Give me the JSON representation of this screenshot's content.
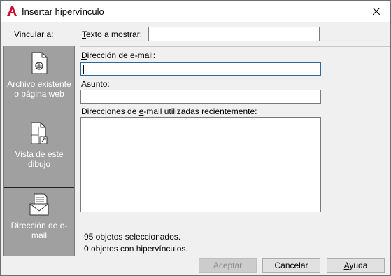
{
  "window": {
    "title": "Insertar hipervínculo",
    "icon": "autocad-a-icon",
    "accent": "#c8102e"
  },
  "link_to": {
    "label": "Vincular a:",
    "items": [
      {
        "label": "Archivo existente o página web",
        "icon": "file-web-icon",
        "selected": false
      },
      {
        "label": "Vista de este dibujo",
        "icon": "drawing-view-icon",
        "selected": false
      },
      {
        "label": "Dirección de e-mail",
        "icon": "email-icon",
        "selected": true
      }
    ]
  },
  "text_to_display": {
    "label_prefix": "T",
    "label_rest": "exto a mostrar:",
    "value": ""
  },
  "email_address": {
    "label_prefix": "D",
    "label_rest": "irección de e-mail:",
    "value": ""
  },
  "subject": {
    "label_prefix": "As",
    "label_u": "u",
    "label_rest": "nto:",
    "value": ""
  },
  "recent_emails": {
    "label_a": "Direcciones de ",
    "label_u": "e",
    "label_b": "-mail utilizadas recientemente:",
    "items": []
  },
  "status": {
    "selected": "95 objetos seleccionados.",
    "with_links": "0 objetos con hipervínculos."
  },
  "buttons": {
    "ok": "Aceptar",
    "cancel": "Cancelar",
    "help_u": "A",
    "help_rest": "yuda"
  }
}
